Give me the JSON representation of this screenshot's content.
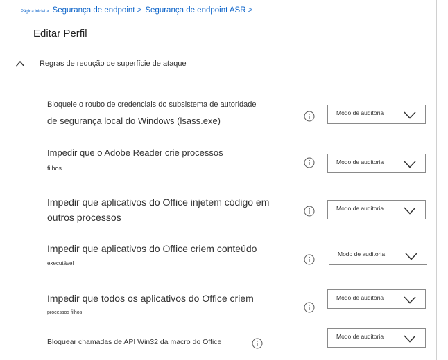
{
  "breadcrumb": {
    "home": "Página inicial >",
    "item1": "Segurança de endpoint >",
    "item2": "Segurança de endpoint ASR >"
  },
  "page_title": "Editar Perfil",
  "section": {
    "label": "Regras de redução de superfície de ataque",
    "expanded": true
  },
  "rules": [
    {
      "line1": "Bloqueie o roubo de credenciais do subsistema de autoridade",
      "line2": "de segurança local do Windows (lsass.exe)",
      "mode": "Modo de auditoria"
    },
    {
      "line1": "Impedir que o Adobe Reader crie processos",
      "line2": "filhos",
      "mode": "Modo de auditoria"
    },
    {
      "line1": "Impedir que aplicativos do Office injetem código em",
      "line2": "outros processos",
      "mode": "Modo de auditoria"
    },
    {
      "line1": "Impedir que aplicativos do Office criem conteúdo",
      "line2": "executável",
      "mode": "Modo de auditoria"
    },
    {
      "line1": "Impedir que todos os aplicativos do Office criem",
      "line2": "processos filhos",
      "mode": "Modo de auditoria"
    },
    {
      "line1": "Bloquear chamadas de API Win32 da macro do Office",
      "mode": "Modo de auditoria"
    }
  ],
  "icons": {
    "section_toggle": "chevron-up-icon",
    "info": "info-icon",
    "dropdown": "chevron-down-icon"
  },
  "colors": {
    "link": "#0b63c9",
    "text": "#333333",
    "border": "#8a8a8a"
  }
}
